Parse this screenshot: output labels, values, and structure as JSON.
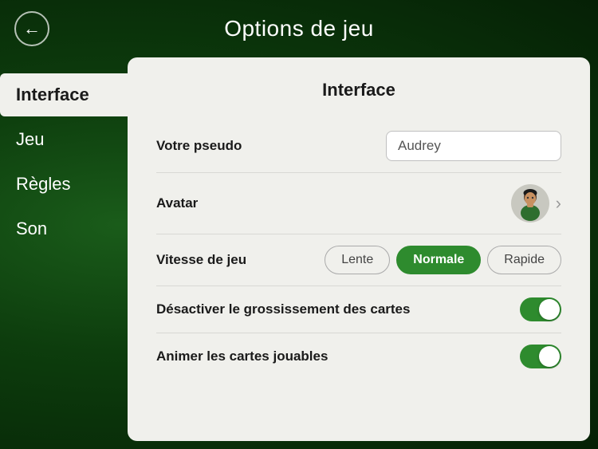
{
  "header": {
    "title": "Options de jeu",
    "back_label": "←"
  },
  "sidebar": {
    "items": [
      {
        "id": "interface",
        "label": "Interface",
        "active": true
      },
      {
        "id": "jeu",
        "label": "Jeu",
        "active": false
      },
      {
        "id": "regles",
        "label": "Règles",
        "active": false
      },
      {
        "id": "son",
        "label": "Son",
        "active": false
      }
    ]
  },
  "panel": {
    "title": "Interface",
    "rows": [
      {
        "id": "pseudo",
        "label": "Votre pseudo",
        "type": "input",
        "value": "Audrey",
        "placeholder": "Audrey"
      },
      {
        "id": "avatar",
        "label": "Avatar",
        "type": "avatar"
      },
      {
        "id": "vitesse",
        "label": "Vitesse de jeu",
        "type": "speed",
        "options": [
          "Lente",
          "Normale",
          "Rapide"
        ],
        "selected": "Normale"
      },
      {
        "id": "grossissement",
        "label": "Désactiver le grossissement des cartes",
        "type": "toggle",
        "enabled": true
      },
      {
        "id": "animer",
        "label": "Animer les cartes jouables",
        "type": "toggle",
        "enabled": true
      }
    ]
  }
}
